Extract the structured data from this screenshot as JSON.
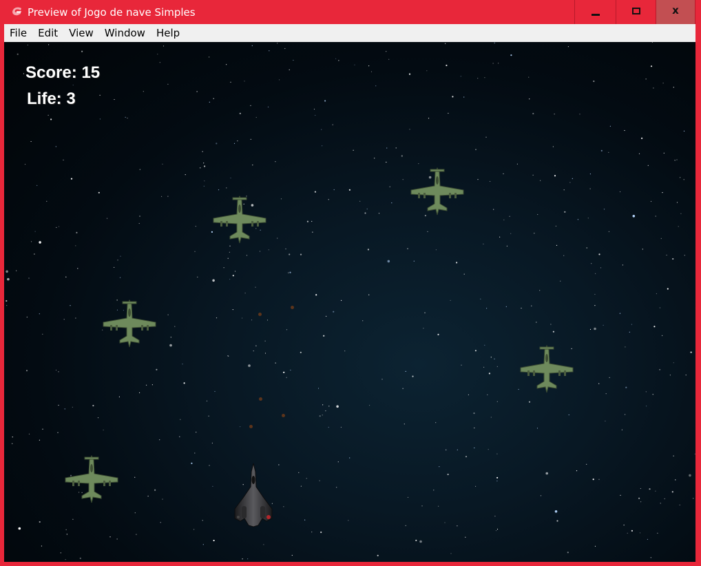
{
  "window": {
    "title": "Preview of Jogo de nave Simples",
    "controls": {
      "minimize": "minimize-icon",
      "maximize": "maximize-icon",
      "close": "x"
    }
  },
  "menu": {
    "items": [
      "File",
      "Edit",
      "View",
      "Window",
      "Help"
    ]
  },
  "game": {
    "score_text": "Score: 15",
    "life_text": "Life: 3",
    "enemy_count": 5,
    "colors": {
      "frame": "#e8273a",
      "enemy": "#6e8a5c",
      "player": "#2c2c2e",
      "space": "#04101a"
    }
  }
}
